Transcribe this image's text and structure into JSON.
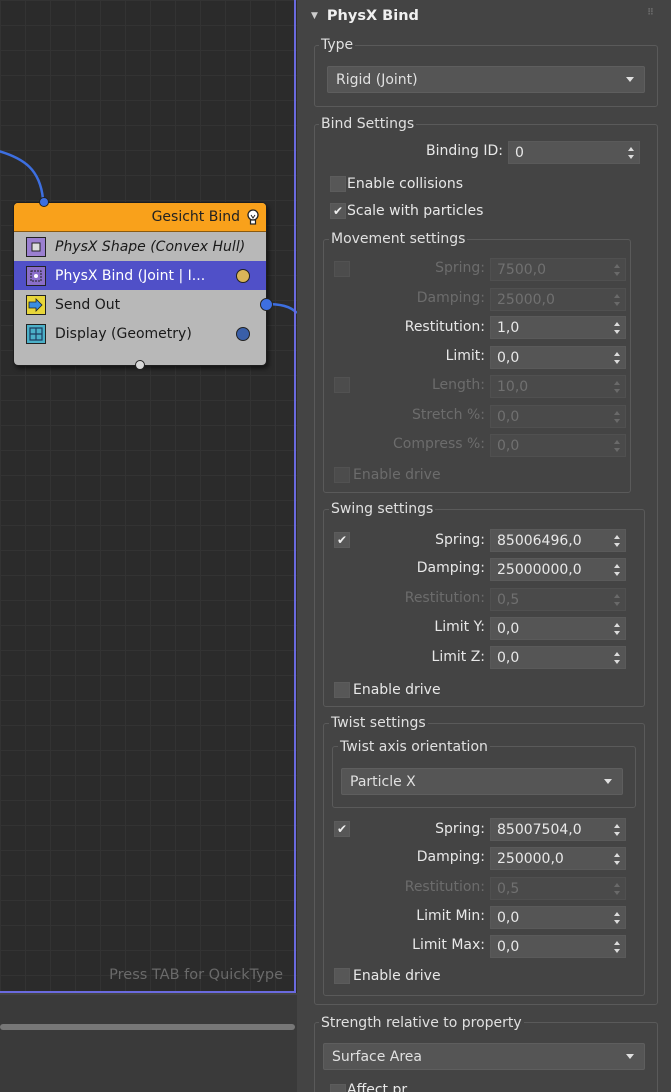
{
  "graph": {
    "hint": "Press TAB for QuickType",
    "node": {
      "title": "Gesicht Bind",
      "rows": [
        {
          "label": "PhysX Shape (Convex Hull)",
          "italic": true,
          "selected": false
        },
        {
          "label": "PhysX Bind (Joint | I...",
          "italic": false,
          "selected": true
        },
        {
          "label": "Send Out",
          "italic": false,
          "selected": false
        },
        {
          "label": "Display (Geometry)",
          "italic": false,
          "selected": false
        }
      ]
    }
  },
  "panel": {
    "title": "PhysX Bind",
    "type": {
      "label": "Type",
      "value": "Rigid (Joint)"
    },
    "bind_settings": {
      "label": "Bind Settings",
      "binding_id_label": "Binding ID:",
      "binding_id": "0",
      "enable_collisions": "Enable collisions",
      "scale_with_particles": "Scale with particles",
      "check": "✔"
    },
    "movement": {
      "label": "Movement settings",
      "spring_label": "Spring:",
      "spring": "7500,0",
      "damping_label": "Damping:",
      "damping": "25000,0",
      "restitution_label": "Restitution:",
      "restitution": "1,0",
      "limit_label": "Limit:",
      "limit": "0,0",
      "length_label": "Length:",
      "length": "10,0",
      "stretch_label": "Stretch %:",
      "stretch": "0,0",
      "compress_label": "Compress %:",
      "compress": "0,0",
      "enable_drive": "Enable drive"
    },
    "swing": {
      "label": "Swing settings",
      "spring_label": "Spring:",
      "spring": "85006496,0",
      "damping_label": "Damping:",
      "damping": "25000000,0",
      "restitution_label": "Restitution:",
      "restitution": "0,5",
      "limit_y_label": "Limit Y:",
      "limit_y": "0,0",
      "limit_z_label": "Limit Z:",
      "limit_z": "0,0",
      "enable_drive": "Enable drive"
    },
    "twist": {
      "label": "Twist settings",
      "axis_label": "Twist axis orientation",
      "axis_value": "Particle X",
      "spring_label": "Spring:",
      "spring": "85007504,0",
      "damping_label": "Damping:",
      "damping": "250000,0",
      "restitution_label": "Restitution:",
      "restitution": "0,5",
      "limit_min_label": "Limit Min:",
      "limit_min": "0,0",
      "limit_max_label": "Limit Max:",
      "limit_max": "0,0",
      "enable_drive": "Enable drive"
    },
    "strength": {
      "label": "Strength relative to property",
      "value": "Surface Area"
    },
    "affect_partial": "Affect pr..."
  },
  "colors": {
    "node_header": "#f9a11b",
    "selection": "#5050c8",
    "wire": "#3d6fe0",
    "canvas_border": "#6a6adf"
  }
}
